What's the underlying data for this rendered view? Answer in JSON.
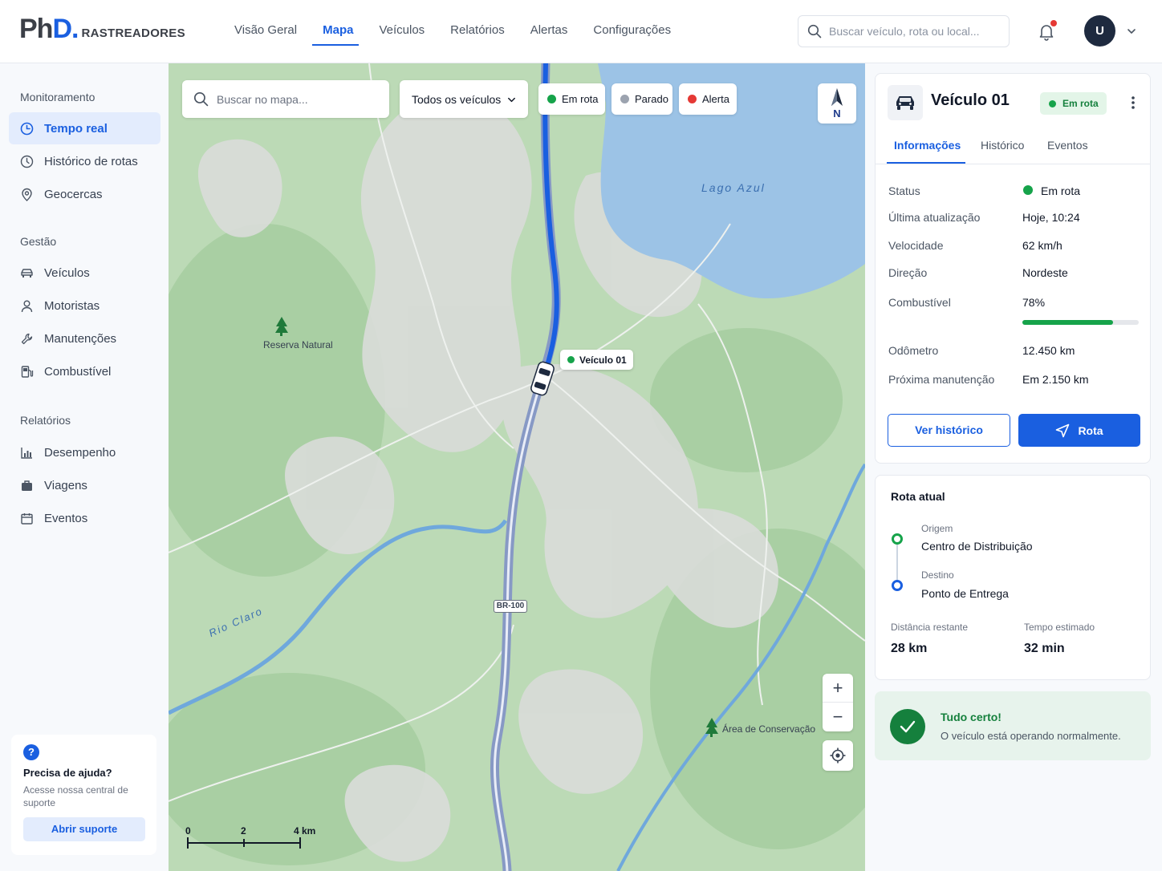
{
  "header": {
    "logo_main": "PhD.",
    "logo_sub": "RASTREADORES",
    "nav": [
      "Visão Geral",
      "Mapa",
      "Veículos",
      "Relatórios",
      "Alertas",
      "Configurações"
    ],
    "active_nav": "Mapa",
    "search_placeholder": "Buscar veículo, rota ou local...",
    "avatar_initial": "U",
    "notification_dot": true
  },
  "sidebar": {
    "sections": [
      {
        "title": "Monitoramento",
        "items": [
          {
            "label": "Tempo real",
            "icon": "realtime-icon",
            "active": true
          },
          {
            "label": "Histórico de rotas",
            "icon": "clock-icon"
          },
          {
            "label": "Geocercas",
            "icon": "location-pin-icon"
          }
        ]
      },
      {
        "title": "Gestão",
        "items": [
          {
            "label": "Veículos",
            "icon": "car-icon"
          },
          {
            "label": "Motoristas",
            "icon": "user-icon"
          },
          {
            "label": "Manutenções",
            "icon": "wrench-icon"
          },
          {
            "label": "Combustível",
            "icon": "fuel-icon"
          }
        ]
      },
      {
        "title": "Relatórios",
        "items": [
          {
            "label": "Desempenho",
            "icon": "bar-chart-icon"
          },
          {
            "label": "Viagens",
            "icon": "suitcase-icon"
          },
          {
            "label": "Eventos",
            "icon": "calendar-icon"
          }
        ]
      }
    ],
    "help": {
      "title": "Precisa de ajuda?",
      "text": "Acesse nossa central de suporte",
      "button": "Abrir suporte"
    }
  },
  "map": {
    "search_placeholder": "Buscar no mapa...",
    "vehicle_filter": "Todos os veículos",
    "legend": [
      {
        "label": "Em rota",
        "color": "#16a34a"
      },
      {
        "label": "Parado",
        "color": "#9ca3af"
      },
      {
        "label": "Alerta",
        "color": "#e53935"
      }
    ],
    "compass_label": "N",
    "places": {
      "lake": "Lago Azul",
      "reserve": "Reserva Natural",
      "conservation": "Área de Conservação",
      "river": "Rio Claro",
      "road": "BR-100"
    },
    "vehicle_tag": "Veículo 01",
    "scale": [
      "0",
      "2",
      "4 km"
    ],
    "zoom_in": "+",
    "zoom_out": "−"
  },
  "vehicle_panel": {
    "title": "Veículo 01",
    "status_badge": "Em rota",
    "tabs": [
      "Informações",
      "Histórico",
      "Eventos"
    ],
    "active_tab": "Informações",
    "info": {
      "status_label": "Status",
      "status_value": "Em rota",
      "update_label": "Última atualização",
      "update_value": "Hoje, 10:24",
      "speed_label": "Velocidade",
      "speed_value": "62 km/h",
      "direction_label": "Direção",
      "direction_value": "Nordeste",
      "fuel_label": "Combustível",
      "fuel_value": "78%",
      "fuel_fraction": 0.78,
      "odometer_label": "Odômetro",
      "odometer_value": "12.450 km",
      "maintenance_label": "Próxima manutenção",
      "maintenance_value": "Em 2.150 km"
    },
    "btn_history": "Ver histórico",
    "btn_route": "Rota"
  },
  "route": {
    "title": "Rota atual",
    "origin_label": "Origem",
    "origin_value": "Centro de Distribuição",
    "dest_label": "Destino",
    "dest_value": "Ponto de Entrega",
    "distance_label": "Distância restante",
    "distance_value": "28 km",
    "eta_label": "Tempo estimado",
    "eta_value": "32 min"
  },
  "status_card": {
    "title": "Tudo certo!",
    "text": "O veículo está operando normalmente."
  },
  "colors": {
    "accent": "#1a5fe0",
    "ok": "#16a34a",
    "alert": "#e53935",
    "stopped": "#9ca3af"
  }
}
